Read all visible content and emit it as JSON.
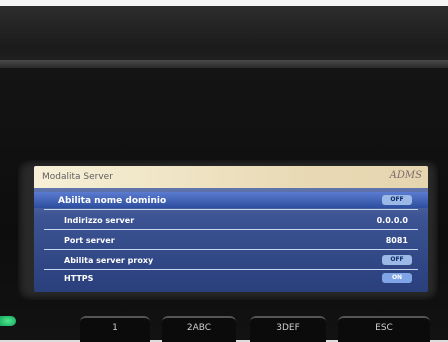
{
  "screen": {
    "header": {
      "title": "Modalita Server",
      "user": "ADMS"
    },
    "rows": [
      {
        "label": "Abilita nome dominio",
        "value": "OFF",
        "is_toggle": true
      },
      {
        "label": "Indirizzo server",
        "value": "0.0.0.0",
        "is_toggle": false
      },
      {
        "label": "Port server",
        "value": "8081",
        "is_toggle": false
      },
      {
        "label": "Abilita server proxy",
        "value": "OFF",
        "is_toggle": true
      },
      {
        "label": "HTTPS",
        "value": "ON",
        "is_toggle": true
      }
    ]
  },
  "keys": [
    {
      "label": "1"
    },
    {
      "label": "2ABC"
    },
    {
      "label": "3DEF"
    },
    {
      "label": "ESC"
    }
  ]
}
